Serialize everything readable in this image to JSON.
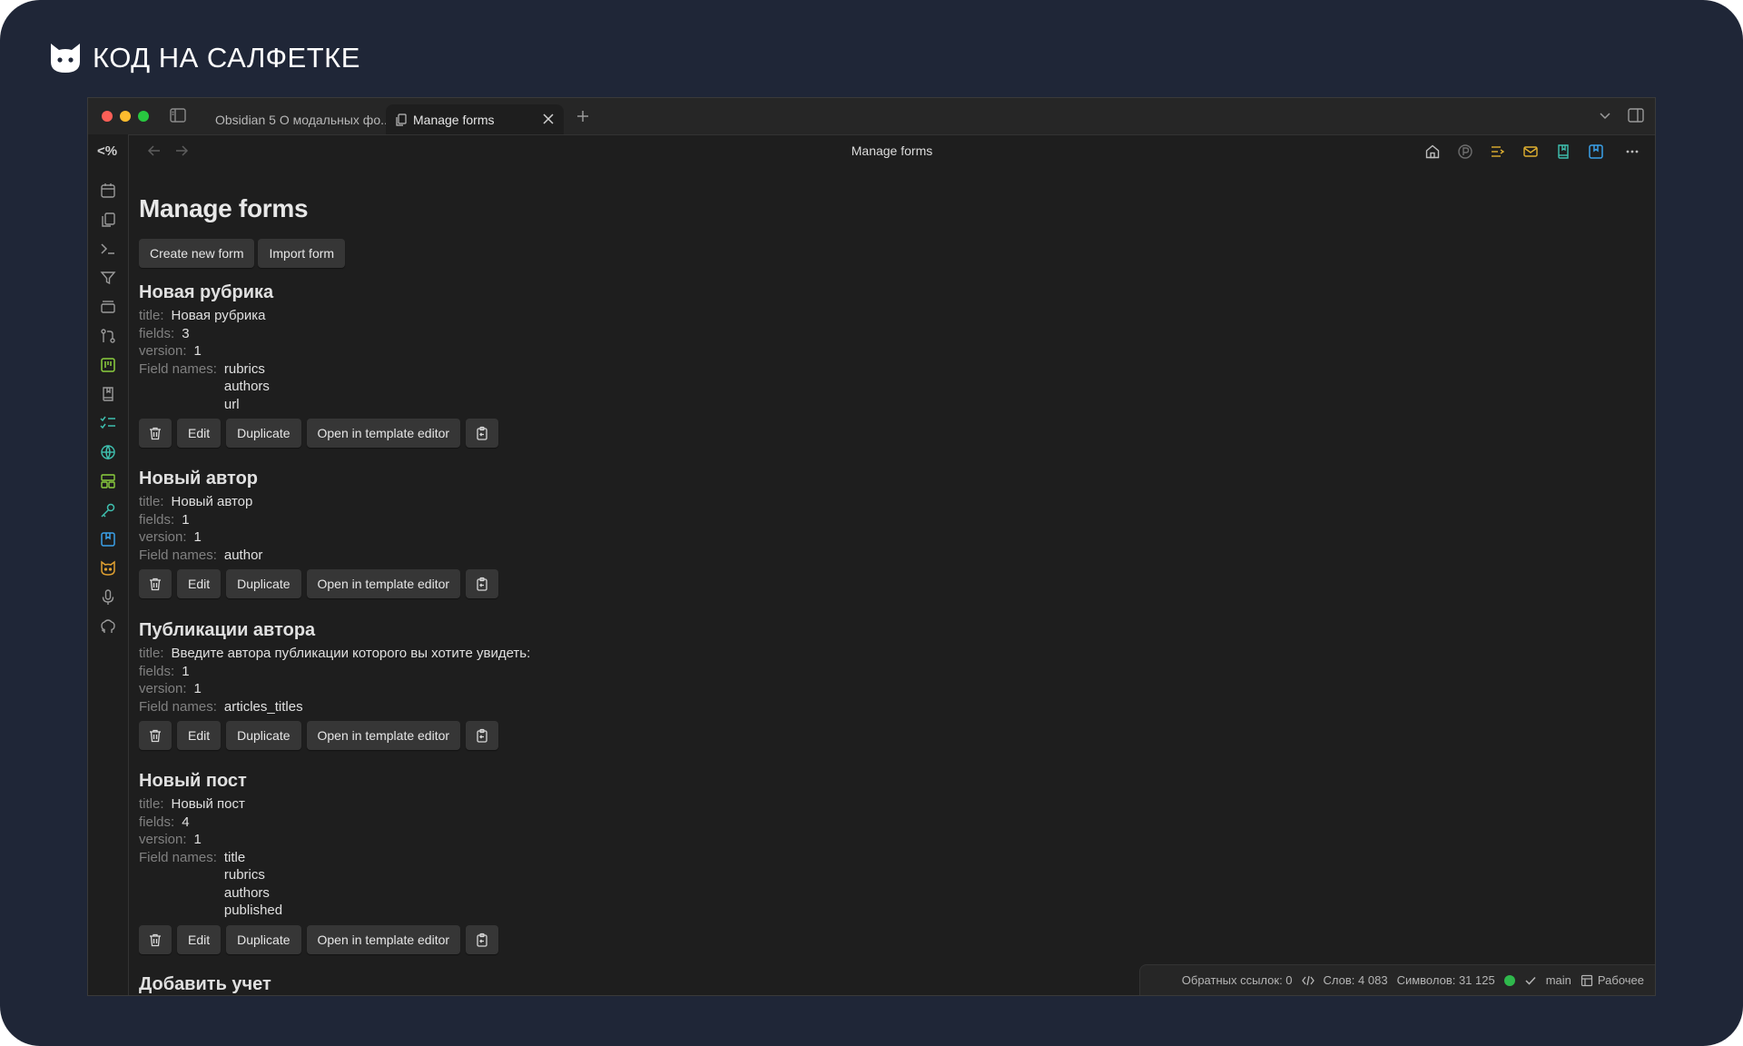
{
  "brand": {
    "name": "КОД НА САЛФЕТКЕ"
  },
  "tabs": [
    {
      "label": "Obsidian 5 О модальных фо..."
    },
    {
      "label": "Manage forms"
    }
  ],
  "nav": {
    "title": "Manage forms"
  },
  "page": {
    "title": "Manage forms",
    "create_label": "Create new form",
    "import_label": "Import form"
  },
  "labels": {
    "title": "title:",
    "fields": "fields:",
    "version": "version:",
    "field_names": "Field names:",
    "edit": "Edit",
    "duplicate": "Duplicate",
    "open_template": "Open in template editor"
  },
  "forms": [
    {
      "name": "Новая рубрика",
      "title": "Новая рубрика",
      "fields": "3",
      "version": "1",
      "field_names": [
        "rubrics",
        "authors",
        "url"
      ]
    },
    {
      "name": "Новый автор",
      "title": "Новый автор",
      "fields": "1",
      "version": "1",
      "field_names": [
        "author"
      ]
    },
    {
      "name": "Публикации автора",
      "title": "Введите автора публикации которого вы хотите увидеть:",
      "fields": "1",
      "version": "1",
      "field_names": [
        "articles_titles"
      ]
    },
    {
      "name": "Новый пост",
      "title": "Новый пост",
      "fields": "4",
      "version": "1",
      "field_names": [
        "title",
        "rubrics",
        "authors",
        "published"
      ]
    },
    {
      "name": "Добавить учет"
    }
  ],
  "status": {
    "backlinks": "Обратных ссылок: 0",
    "words": "Слов: 4 083",
    "chars": "Символов: 31 125",
    "branch": "main",
    "workspace": "Рабочее"
  },
  "ribbon": {
    "code_label": "<%"
  },
  "colors": {
    "background": "#1f2637",
    "window": "#1e1e1e",
    "button": "#363636",
    "accent_green": "#2fb84c"
  }
}
